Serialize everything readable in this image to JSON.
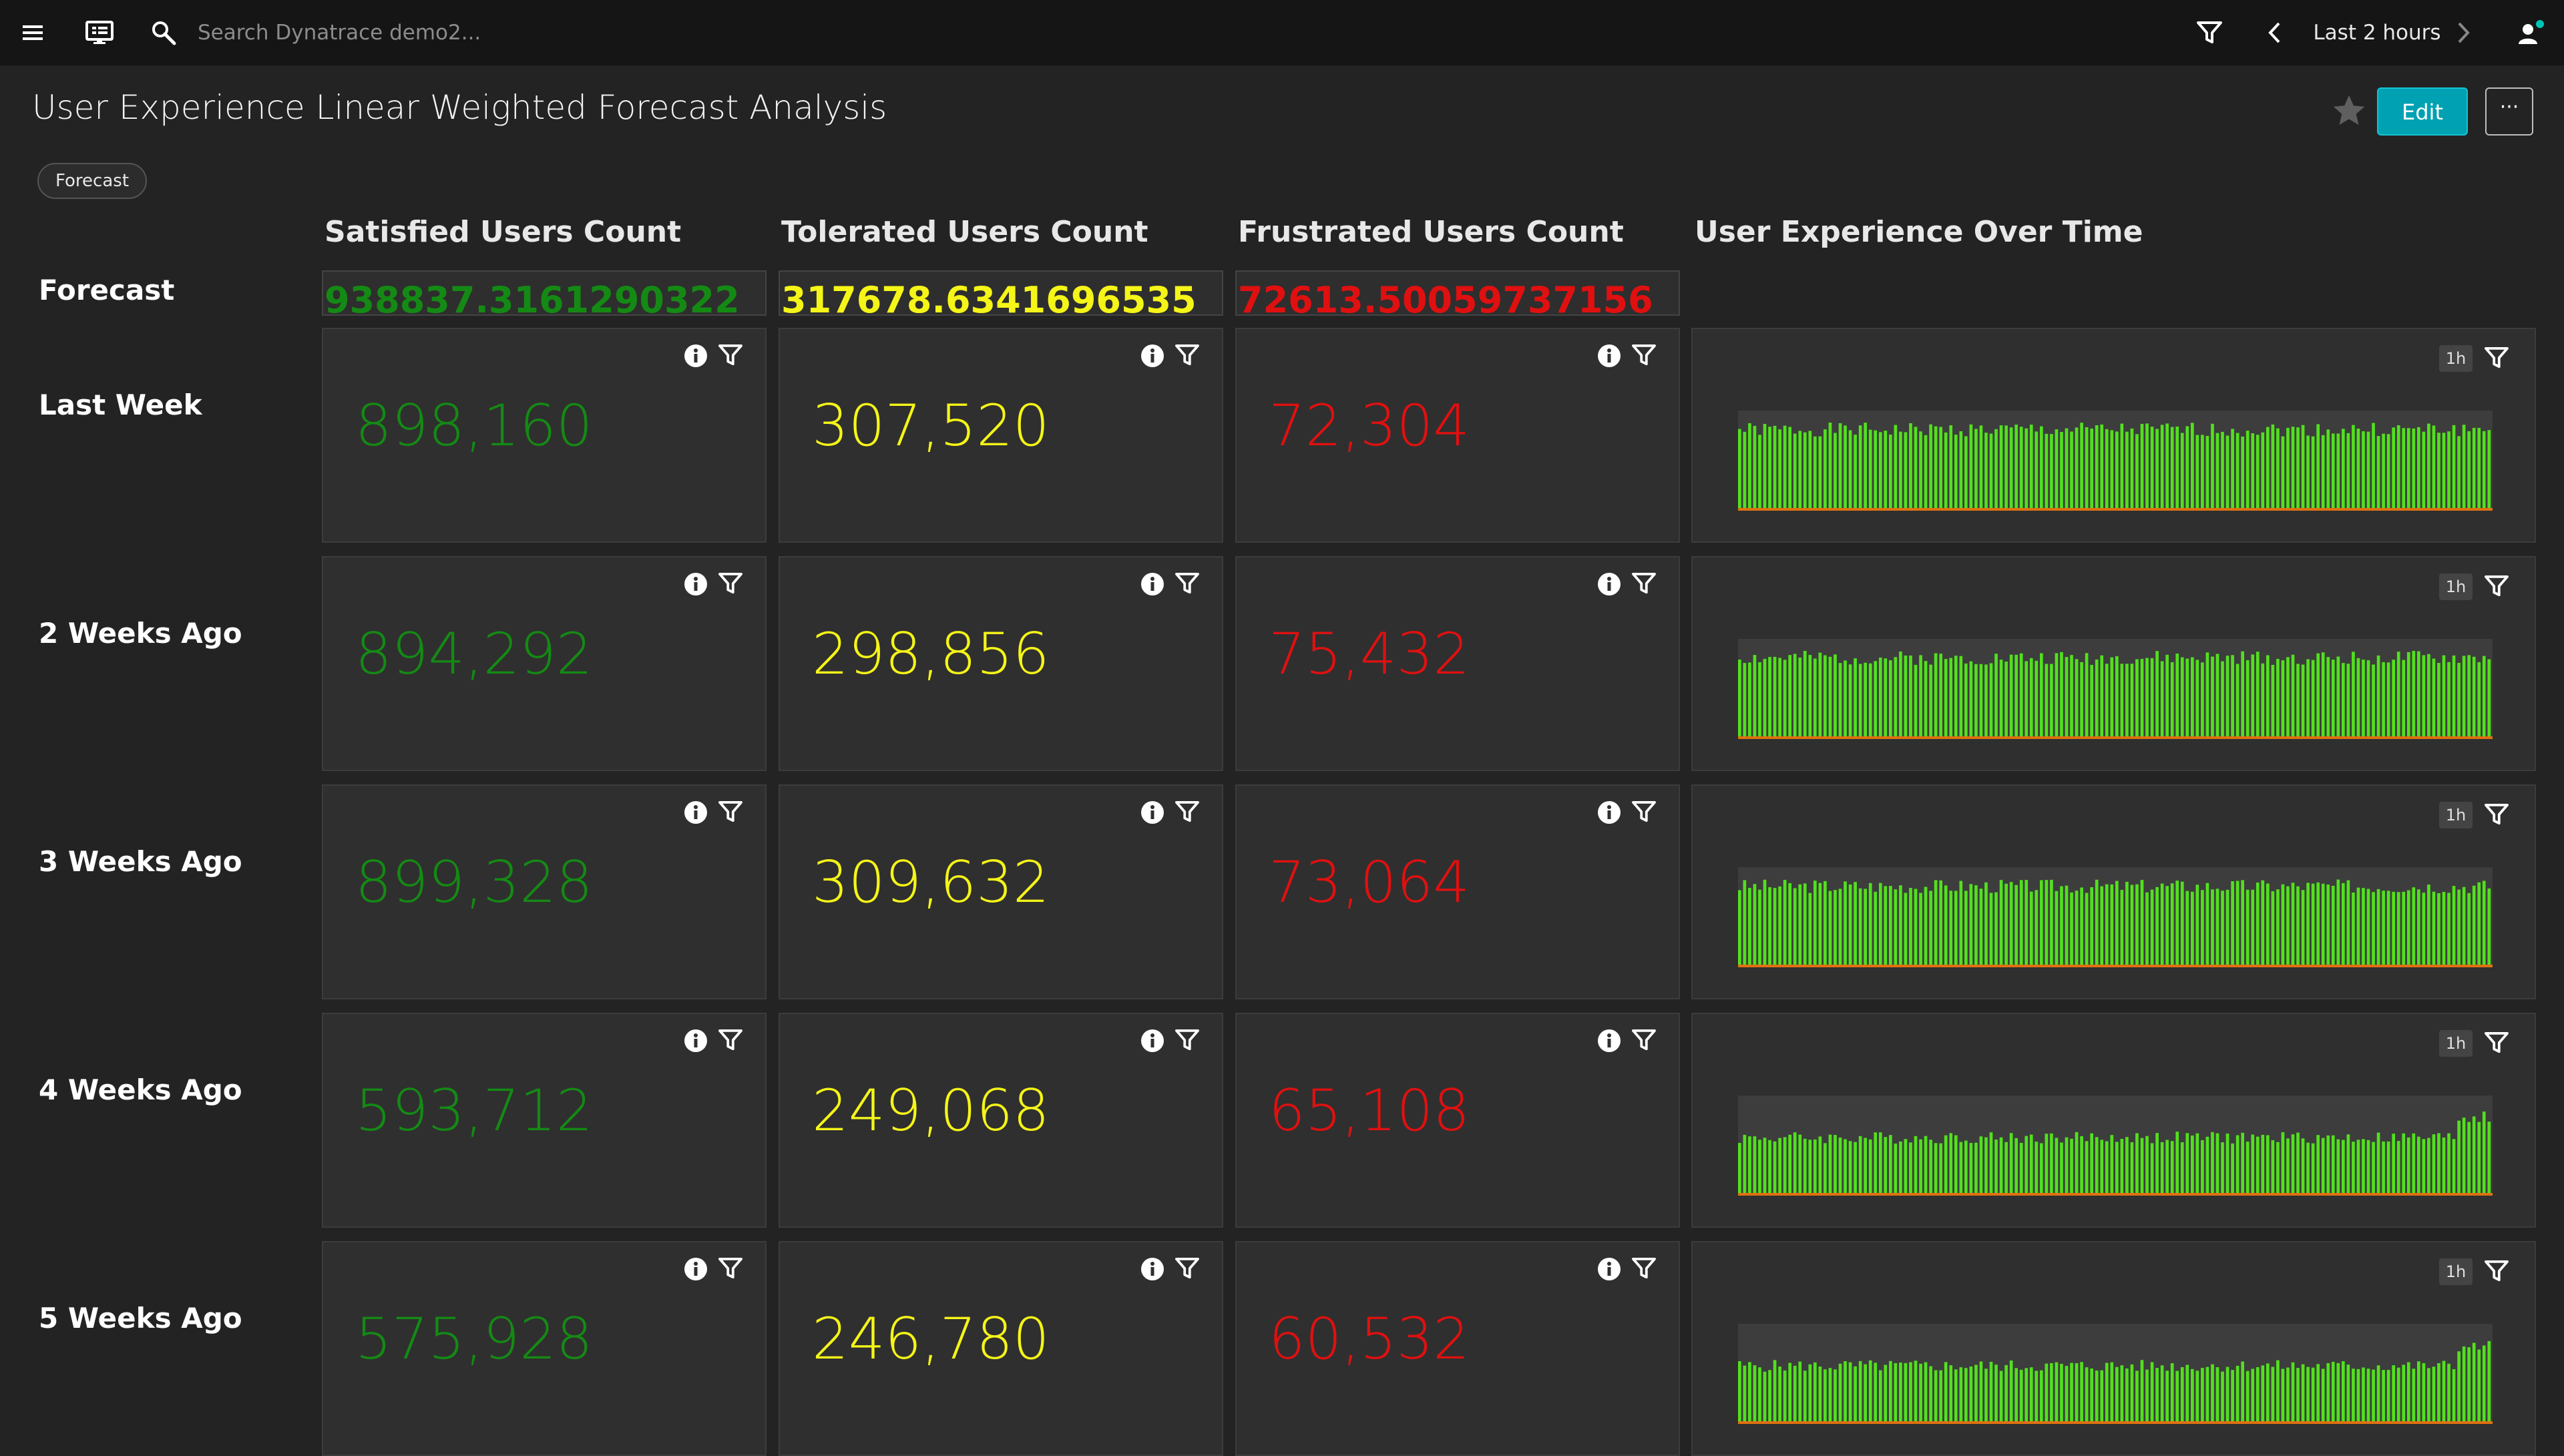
{
  "topbar": {
    "search_placeholder": "Search Dynatrace demo2...",
    "timeframe_label": "Last 2 hours"
  },
  "page": {
    "title": "User Experience Linear Weighted Forecast Analysis",
    "tag": "Forecast",
    "edit_label": "Edit",
    "more_label": "···"
  },
  "columns": {
    "satisfied": "Satisfied Users Count",
    "tolerated": "Tolerated Users Count",
    "frustrated": "Frustrated Users Count",
    "over_time": "User Experience Over Time"
  },
  "rows": [
    {
      "label": "Forecast",
      "satisfied": "938837.3161290322",
      "tolerated": "317678.6341696535",
      "frustrated": "72613.50059737156"
    },
    {
      "label": "Last Week",
      "satisfied": "898,160",
      "tolerated": "307,520",
      "frustrated": "72,304",
      "resolution": "1h"
    },
    {
      "label": "2 Weeks Ago",
      "satisfied": "894,292",
      "tolerated": "298,856",
      "frustrated": "75,432",
      "resolution": "1h"
    },
    {
      "label": "3 Weeks Ago",
      "satisfied": "899,328",
      "tolerated": "309,632",
      "frustrated": "73,064",
      "resolution": "1h"
    },
    {
      "label": "4 Weeks Ago",
      "satisfied": "593,712",
      "tolerated": "249,068",
      "frustrated": "65,108",
      "resolution": "1h"
    },
    {
      "label": "5 Weeks Ago",
      "satisfied": "575,928",
      "tolerated": "246,780",
      "frustrated": "60,532",
      "resolution": "1h"
    }
  ],
  "colors": {
    "satisfied": "#148a14",
    "tolerated": "#f5f518",
    "frustrated": "#e01010",
    "accent": "#00a1b2",
    "bar": "#52e01e"
  },
  "icons": [
    "menu-icon",
    "dashboard-icon",
    "search-icon",
    "filter-icon",
    "chevron-left-icon",
    "chevron-right-icon",
    "user-icon",
    "star-icon",
    "info-icon"
  ]
}
